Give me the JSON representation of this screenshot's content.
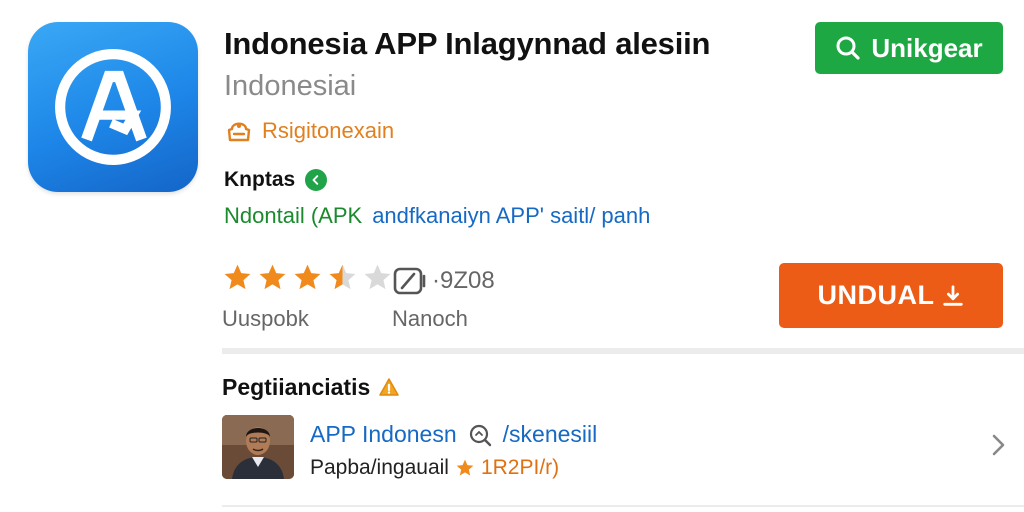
{
  "app": {
    "title": "Indonesia APP Inlagynnad alesiin",
    "subtitle": "Indonesiai",
    "developer": "Rsigitonexain",
    "category": "Knptas",
    "download_info": "Ndontail (APK",
    "download_link": "andfkanaiyn APP' saitl/ panh"
  },
  "search_button": {
    "label": "Unikgear"
  },
  "rating": {
    "stars": 3.5,
    "max": 5,
    "label": "Uuspobk"
  },
  "size": {
    "value": "·9Z08",
    "label": "Nanoch"
  },
  "install_button": {
    "label": "UNDUAL"
  },
  "section": {
    "title": "Pegtiianciatis"
  },
  "review": {
    "title": "APP Indonesn",
    "tag": "/skenesiil",
    "author": "Papba/ingauail",
    "rating_text": "1R2PI/r)"
  },
  "colors": {
    "accent_green": "#1ea844",
    "install_orange": "#ec5c16",
    "star_orange": "#f08a1c",
    "link_blue": "#1669c4",
    "icon_blue": "#1d86e8"
  },
  "icons": {
    "app": "app-store-icon",
    "developer": "developer-icon",
    "verified": "verified-icon",
    "search": "search-icon",
    "size": "storage-icon",
    "install": "download-icon",
    "section": "warning-icon",
    "chevron": "chevron-right-icon"
  }
}
